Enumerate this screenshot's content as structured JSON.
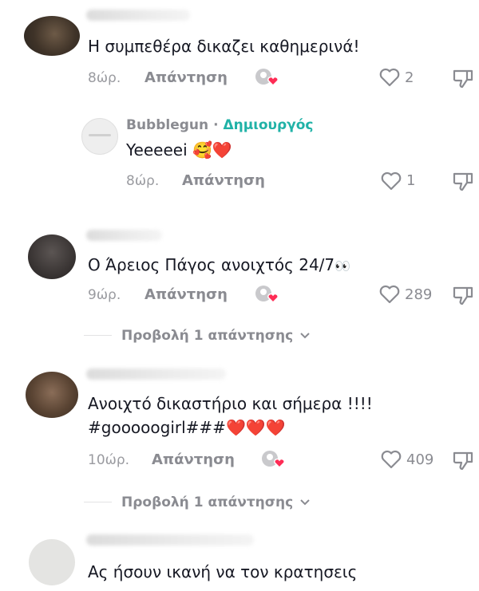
{
  "comments": [
    {
      "text": "Η συμπεθέρα δικαζει καθημερινά!",
      "time": "8ώρ.",
      "reply_label": "Απάντηση",
      "likes": "2"
    },
    {
      "author": "Bubblegun",
      "separator": "·",
      "author_badge": "Δημιουργός",
      "text": "Yeeeeei",
      "emoji": "🥰❤️",
      "time": "8ώρ.",
      "reply_label": "Απάντηση",
      "likes": "1"
    },
    {
      "text": "Ο Άρειος Πάγος ανοιχτός 24/7",
      "emoji": "👀",
      "time": "9ώρ.",
      "reply_label": "Απάντηση",
      "likes": "289",
      "view_replies": "Προβολή 1 απάντησης"
    },
    {
      "text_line1": "Ανοιχτό δικαστήριο και σήμερα !!!!",
      "text_line2": "#gooooogirl###",
      "emoji": "❤️❤️❤️",
      "time": "10ώρ.",
      "reply_label": "Απάντηση",
      "likes": "409",
      "view_replies": "Προβολή 1 απάντησης"
    },
    {
      "text": "Ας ήσουν ικανή να τον κρατησεις"
    }
  ],
  "icons": {
    "like": "heart-outline-icon",
    "dislike": "thumbs-down-icon",
    "creator_liked": "creator-liked-heart-icon",
    "expand": "chevron-down-icon"
  },
  "colors": {
    "creator_badge": "#20b2a7",
    "heart_red": "#fe2c55"
  }
}
